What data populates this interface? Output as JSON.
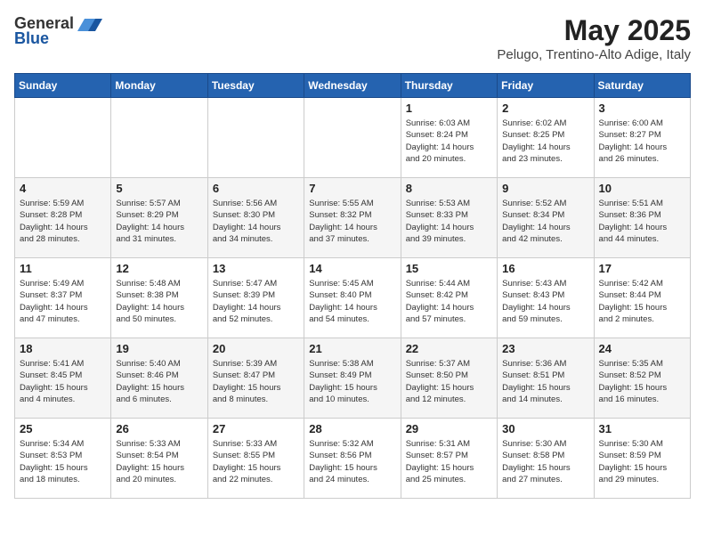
{
  "header": {
    "logo_general": "General",
    "logo_blue": "Blue",
    "month": "May 2025",
    "location": "Pelugo, Trentino-Alto Adige, Italy"
  },
  "days_of_week": [
    "Sunday",
    "Monday",
    "Tuesday",
    "Wednesday",
    "Thursday",
    "Friday",
    "Saturday"
  ],
  "weeks": [
    [
      {
        "day": "",
        "info": ""
      },
      {
        "day": "",
        "info": ""
      },
      {
        "day": "",
        "info": ""
      },
      {
        "day": "",
        "info": ""
      },
      {
        "day": "1",
        "info": "Sunrise: 6:03 AM\nSunset: 8:24 PM\nDaylight: 14 hours\nand 20 minutes."
      },
      {
        "day": "2",
        "info": "Sunrise: 6:02 AM\nSunset: 8:25 PM\nDaylight: 14 hours\nand 23 minutes."
      },
      {
        "day": "3",
        "info": "Sunrise: 6:00 AM\nSunset: 8:27 PM\nDaylight: 14 hours\nand 26 minutes."
      }
    ],
    [
      {
        "day": "4",
        "info": "Sunrise: 5:59 AM\nSunset: 8:28 PM\nDaylight: 14 hours\nand 28 minutes."
      },
      {
        "day": "5",
        "info": "Sunrise: 5:57 AM\nSunset: 8:29 PM\nDaylight: 14 hours\nand 31 minutes."
      },
      {
        "day": "6",
        "info": "Sunrise: 5:56 AM\nSunset: 8:30 PM\nDaylight: 14 hours\nand 34 minutes."
      },
      {
        "day": "7",
        "info": "Sunrise: 5:55 AM\nSunset: 8:32 PM\nDaylight: 14 hours\nand 37 minutes."
      },
      {
        "day": "8",
        "info": "Sunrise: 5:53 AM\nSunset: 8:33 PM\nDaylight: 14 hours\nand 39 minutes."
      },
      {
        "day": "9",
        "info": "Sunrise: 5:52 AM\nSunset: 8:34 PM\nDaylight: 14 hours\nand 42 minutes."
      },
      {
        "day": "10",
        "info": "Sunrise: 5:51 AM\nSunset: 8:36 PM\nDaylight: 14 hours\nand 44 minutes."
      }
    ],
    [
      {
        "day": "11",
        "info": "Sunrise: 5:49 AM\nSunset: 8:37 PM\nDaylight: 14 hours\nand 47 minutes."
      },
      {
        "day": "12",
        "info": "Sunrise: 5:48 AM\nSunset: 8:38 PM\nDaylight: 14 hours\nand 50 minutes."
      },
      {
        "day": "13",
        "info": "Sunrise: 5:47 AM\nSunset: 8:39 PM\nDaylight: 14 hours\nand 52 minutes."
      },
      {
        "day": "14",
        "info": "Sunrise: 5:45 AM\nSunset: 8:40 PM\nDaylight: 14 hours\nand 54 minutes."
      },
      {
        "day": "15",
        "info": "Sunrise: 5:44 AM\nSunset: 8:42 PM\nDaylight: 14 hours\nand 57 minutes."
      },
      {
        "day": "16",
        "info": "Sunrise: 5:43 AM\nSunset: 8:43 PM\nDaylight: 14 hours\nand 59 minutes."
      },
      {
        "day": "17",
        "info": "Sunrise: 5:42 AM\nSunset: 8:44 PM\nDaylight: 15 hours\nand 2 minutes."
      }
    ],
    [
      {
        "day": "18",
        "info": "Sunrise: 5:41 AM\nSunset: 8:45 PM\nDaylight: 15 hours\nand 4 minutes."
      },
      {
        "day": "19",
        "info": "Sunrise: 5:40 AM\nSunset: 8:46 PM\nDaylight: 15 hours\nand 6 minutes."
      },
      {
        "day": "20",
        "info": "Sunrise: 5:39 AM\nSunset: 8:47 PM\nDaylight: 15 hours\nand 8 minutes."
      },
      {
        "day": "21",
        "info": "Sunrise: 5:38 AM\nSunset: 8:49 PM\nDaylight: 15 hours\nand 10 minutes."
      },
      {
        "day": "22",
        "info": "Sunrise: 5:37 AM\nSunset: 8:50 PM\nDaylight: 15 hours\nand 12 minutes."
      },
      {
        "day": "23",
        "info": "Sunrise: 5:36 AM\nSunset: 8:51 PM\nDaylight: 15 hours\nand 14 minutes."
      },
      {
        "day": "24",
        "info": "Sunrise: 5:35 AM\nSunset: 8:52 PM\nDaylight: 15 hours\nand 16 minutes."
      }
    ],
    [
      {
        "day": "25",
        "info": "Sunrise: 5:34 AM\nSunset: 8:53 PM\nDaylight: 15 hours\nand 18 minutes."
      },
      {
        "day": "26",
        "info": "Sunrise: 5:33 AM\nSunset: 8:54 PM\nDaylight: 15 hours\nand 20 minutes."
      },
      {
        "day": "27",
        "info": "Sunrise: 5:33 AM\nSunset: 8:55 PM\nDaylight: 15 hours\nand 22 minutes."
      },
      {
        "day": "28",
        "info": "Sunrise: 5:32 AM\nSunset: 8:56 PM\nDaylight: 15 hours\nand 24 minutes."
      },
      {
        "day": "29",
        "info": "Sunrise: 5:31 AM\nSunset: 8:57 PM\nDaylight: 15 hours\nand 25 minutes."
      },
      {
        "day": "30",
        "info": "Sunrise: 5:30 AM\nSunset: 8:58 PM\nDaylight: 15 hours\nand 27 minutes."
      },
      {
        "day": "31",
        "info": "Sunrise: 5:30 AM\nSunset: 8:59 PM\nDaylight: 15 hours\nand 29 minutes."
      }
    ]
  ],
  "colors": {
    "header_bg": "#2563b0",
    "accent": "#1a4a8a"
  }
}
